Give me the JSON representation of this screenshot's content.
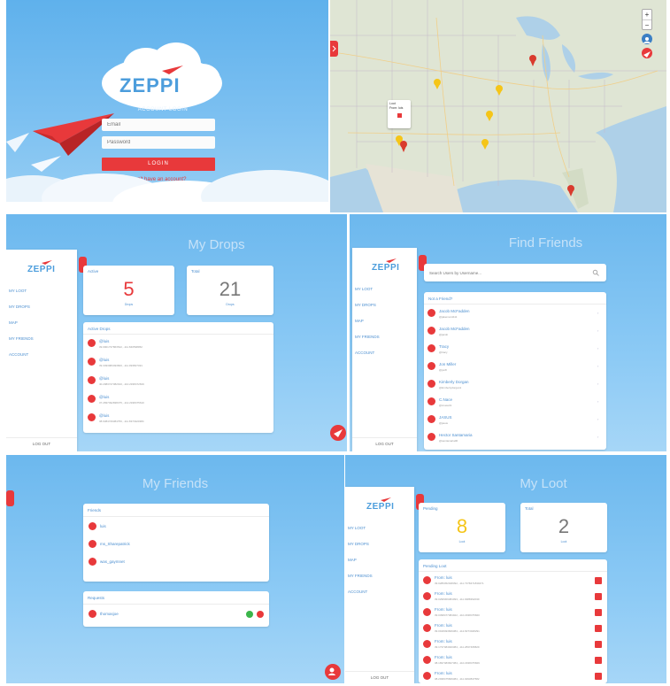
{
  "login": {
    "brand": "ZEPPI",
    "subtitle": "ACCOUNT LOGIN",
    "email_placeholder": "Email",
    "password_placeholder": "Password",
    "login_label": "LOGIN",
    "signup_link": "Don't have an account?"
  },
  "map": {
    "zoom_in": "+",
    "zoom_out": "−",
    "popup_line1": "Loot",
    "popup_line2": "From: luis"
  },
  "app": {
    "brand": "ZEPPI",
    "nav": [
      "MY LOOT",
      "MY DROPS",
      "MAP",
      "MY FRIENDS",
      "ACCOUNT"
    ],
    "logout": "LOG OUT"
  },
  "drops": {
    "title": "My Drops",
    "active_label": "Active",
    "active_value": "5",
    "active_caption": "Drops",
    "total_label": "Total",
    "total_value": "21",
    "total_caption": "Drops",
    "list_title": "Active Drops",
    "items": [
      {
        "name": "@luis",
        "sub": "39.0901737863542, -111.840598952"
      },
      {
        "name": "@luis",
        "sub": "39.3493983493820, -111.993827491"
      },
      {
        "name": "@luis",
        "sub": "40.2983747382910, -110.2938472819"
      },
      {
        "name": "@luis",
        "sub": "37.2837492838475, -112.2938475610"
      },
      {
        "name": "@luis",
        "sub": "38.9384729384756, -111.8374920384"
      }
    ]
  },
  "find": {
    "title": "Find Friends",
    "search_placeholder": "Search Users by Username...",
    "list_title": "Not a Friend?",
    "users": [
      {
        "name": "Jacob McFadden",
        "sub": "@jakeman1111"
      },
      {
        "name": "Jacob McFadden",
        "sub": "@jacob"
      },
      {
        "name": "Tracy",
        "sub": "@tracy"
      },
      {
        "name": "Jon Miller",
        "sub": "@jon8"
      },
      {
        "name": "Kimberly Dorgan",
        "sub": "@kimberlydorgan1"
      },
      {
        "name": "C.Nace",
        "sub": "@cnace01"
      },
      {
        "name": "JASUS",
        "sub": "@jasus"
      },
      {
        "name": "Hector Santamaria",
        "sub": "@santamaria00"
      }
    ]
  },
  "friends": {
    "title": "My Friends",
    "friends_label": "Friends",
    "friends": [
      "luis",
      "ms_Sharepatrick",
      "was_gaymnet"
    ],
    "requests_label": "Requests",
    "requests": [
      "thomasjoe"
    ]
  },
  "loot": {
    "title": "My Loot",
    "pending_label": "Pending",
    "pending_value": "8",
    "pending_caption": "Loot",
    "total_label": "Total",
    "total_value": "2",
    "total_caption": "Loot",
    "list_title": "Pending Loot",
    "items": [
      {
        "name": "From: luis",
        "sub": "39.0286452948392, -111.7378471839471"
      },
      {
        "name": "From: luis",
        "sub": "39.0298309384093, -111.9388392039"
      },
      {
        "name": "From: luis",
        "sub": "39.0398477384922, -110.2938475820"
      },
      {
        "name": "From: luis",
        "sub": "39.0918493829384, -112.8273948291"
      },
      {
        "name": "From: luis",
        "sub": "39.1737484920384, -111.2837495829"
      },
      {
        "name": "From: luis",
        "sub": "38.1837483827384, -110.2938475829"
      },
      {
        "name": "From: luis",
        "sub": "38.2938475829384, -111.0293847582"
      }
    ]
  },
  "colors": {
    "accent_red": "#e8393b",
    "brand_blue": "#4c9ddc",
    "pending_yellow": "#f5c518"
  }
}
